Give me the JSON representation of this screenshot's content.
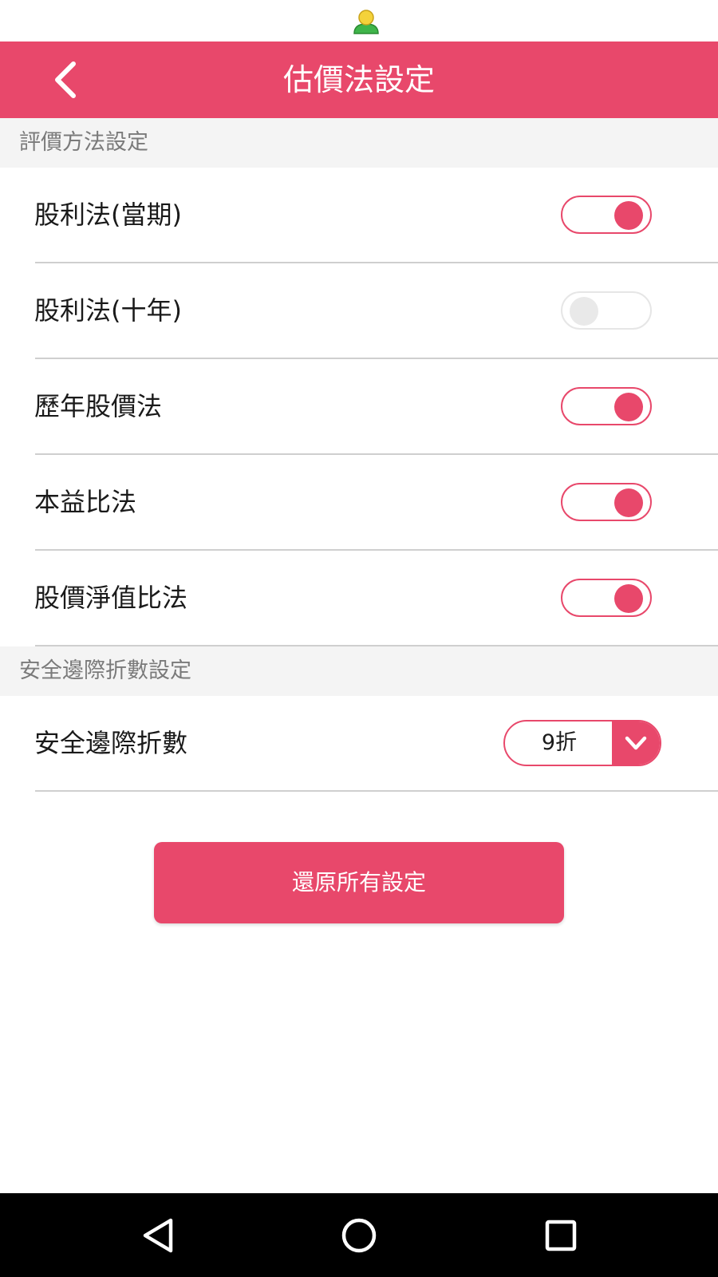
{
  "header": {
    "title": "估價法設定",
    "back_icon": "chevron-left-icon"
  },
  "sections": [
    {
      "title": "評價方法設定",
      "items": [
        {
          "label": "股利法(當期)",
          "enabled": true
        },
        {
          "label": "股利法(十年)",
          "enabled": false
        },
        {
          "label": "歷年股價法",
          "enabled": true
        },
        {
          "label": "本益比法",
          "enabled": true
        },
        {
          "label": "股價淨值比法",
          "enabled": true
        }
      ]
    },
    {
      "title": "安全邊際折數設定",
      "items": [
        {
          "label": "安全邊際折數",
          "value": "9折"
        }
      ]
    }
  ],
  "reset_button": {
    "label": "還原所有設定"
  },
  "colors": {
    "accent": "#e8486b",
    "toggle_off": "#e9e9e9",
    "divider": "#cfcfcf",
    "section_bg": "#f4f4f4"
  },
  "nav": {
    "back_icon": "nav-back-icon",
    "home_icon": "nav-home-icon",
    "recents_icon": "nav-recents-icon"
  }
}
